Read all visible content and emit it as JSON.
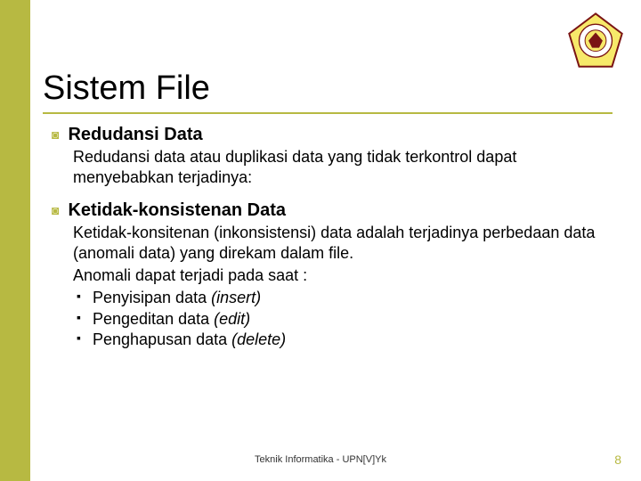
{
  "title": "Sistem File",
  "sections": [
    {
      "heading": "Redudansi Data",
      "paragraphs": [
        "Redudansi data atau duplikasi data yang tidak terkontrol dapat menyebabkan terjadinya:"
      ],
      "sublist": []
    },
    {
      "heading": "Ketidak-konsistenan Data",
      "paragraphs": [
        "Ketidak-konsitenan (inkonsistensi) data adalah terjadinya perbedaan data (anomali data) yang direkam dalam file.",
        "Anomali dapat terjadi pada saat :"
      ],
      "sublist": [
        {
          "text": "Penyisipan data ",
          "italic": "(insert)"
        },
        {
          "text": "Pengeditan data ",
          "italic": "(edit)"
        },
        {
          "text": "Penghapusan data ",
          "italic": "(delete)"
        }
      ]
    }
  ],
  "footer": "Teknik Informatika - UPN[V]Yk",
  "page_number": "8"
}
